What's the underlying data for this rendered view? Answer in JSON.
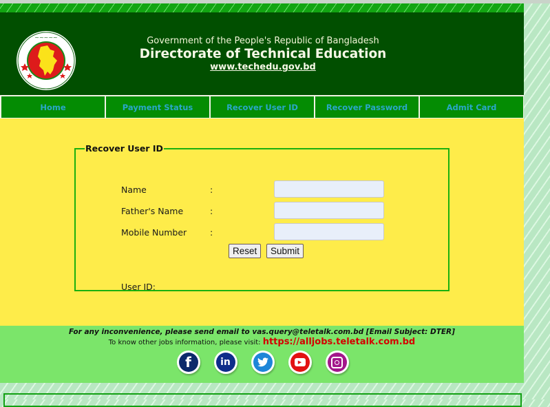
{
  "header": {
    "government_line": "Government of the People's Republic of Bangladesh",
    "title": "Directorate of Technical Education",
    "website": "www.techedu.gov.bd",
    "logo": "bangladesh-government-seal-icon"
  },
  "nav": {
    "items": [
      {
        "label": "Home"
      },
      {
        "label": "Payment Status"
      },
      {
        "label": "Recover User ID"
      },
      {
        "label": "Recover Password"
      },
      {
        "label": "Admit Card"
      }
    ]
  },
  "form": {
    "legend": "Recover User ID",
    "fields": [
      {
        "label": "Name",
        "separator": ":",
        "value": "",
        "placeholder": ""
      },
      {
        "label": "Father's Name",
        "separator": ":",
        "value": "",
        "placeholder": ""
      },
      {
        "label": "Mobile Number",
        "separator": ":",
        "value": "",
        "placeholder": ""
      }
    ],
    "reset_label": "Reset",
    "submit_label": "Submit",
    "result_label": "User ID:",
    "result_value": ""
  },
  "footer": {
    "support_line": "For any inconvenience, please send email to vas.query@teletalk.com.bd  [Email Subject: DTER]",
    "jobs_prefix": "To know other jobs information, please visit:",
    "jobs_link": "https://alljobs.teletalk.com.bd",
    "social": [
      {
        "name": "facebook-icon",
        "glyph": "f",
        "color": "#0c2a6b"
      },
      {
        "name": "linkedin-icon",
        "glyph": "in",
        "color": "#0e2d8a"
      },
      {
        "name": "twitter-icon",
        "glyph": "🕊",
        "color": "#1d86d8"
      },
      {
        "name": "youtube-icon",
        "glyph": "▶",
        "color": "#e21212"
      },
      {
        "name": "instagram-icon",
        "glyph": "◎",
        "color": "#a3168b"
      }
    ]
  },
  "colors": {
    "header_bg": "#014f00",
    "nav_bg": "#048c03",
    "nav_text": "#2aa7c8",
    "main_bg": "#feec4a",
    "footer_bg": "#7be56a",
    "fieldset_border": "#19b00e",
    "link_red": "#d40000"
  }
}
